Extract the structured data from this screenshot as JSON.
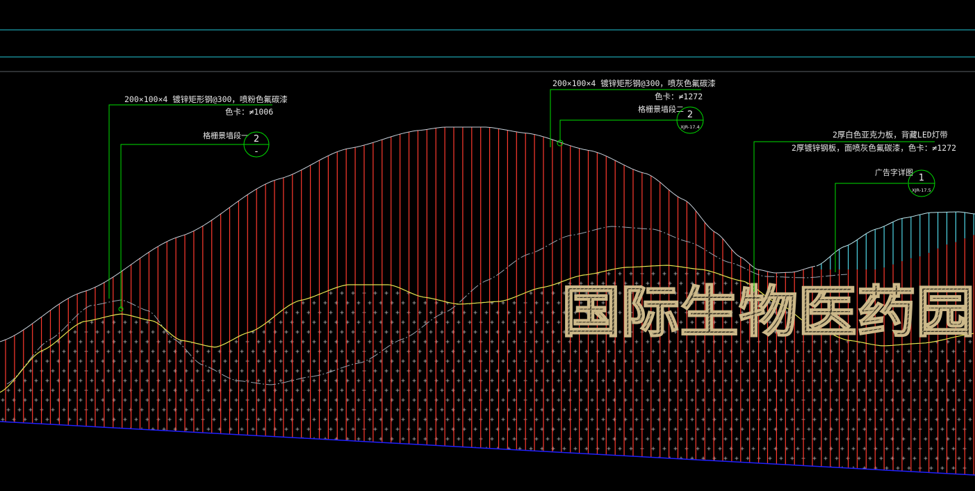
{
  "drawing": {
    "colors": {
      "background": "#000000",
      "border_line": "#22c8d8",
      "leader": "#00e000",
      "slat": "#ff3a2e",
      "slat_cyan": "#4fd6e6",
      "curve_yellow": "#e6e650",
      "curve_gray": "#9aa6b2",
      "ground": "#2020ff",
      "sign_text": "#cdb98a"
    },
    "callouts": {
      "left": {
        "spec_line": "200×100×4 镀锌矩形钢@300，喷粉色氟碳漆",
        "color_card": "色卡：≠1006",
        "detail_label": "格栅景墙段一",
        "detail_number": "2",
        "detail_ref": "-"
      },
      "center": {
        "spec_line": "200×100×4 镀锌矩形钢@300，喷灰色氟碳漆",
        "color_card": "色卡：≠1272",
        "detail_label": "格栅景墙段二",
        "detail_number": "2",
        "detail_ref": "XJR-17.4"
      },
      "right": {
        "line_1": "2厚白色亚克力板，背藏LED灯带",
        "line_2": "2厚镀锌钢板，面喷灰色氟碳漆，色卡：≠1272",
        "detail_label": "广告字详图",
        "detail_number": "1",
        "detail_ref": "XJR-17.5"
      }
    },
    "sign_text": "国际生物医药园"
  }
}
